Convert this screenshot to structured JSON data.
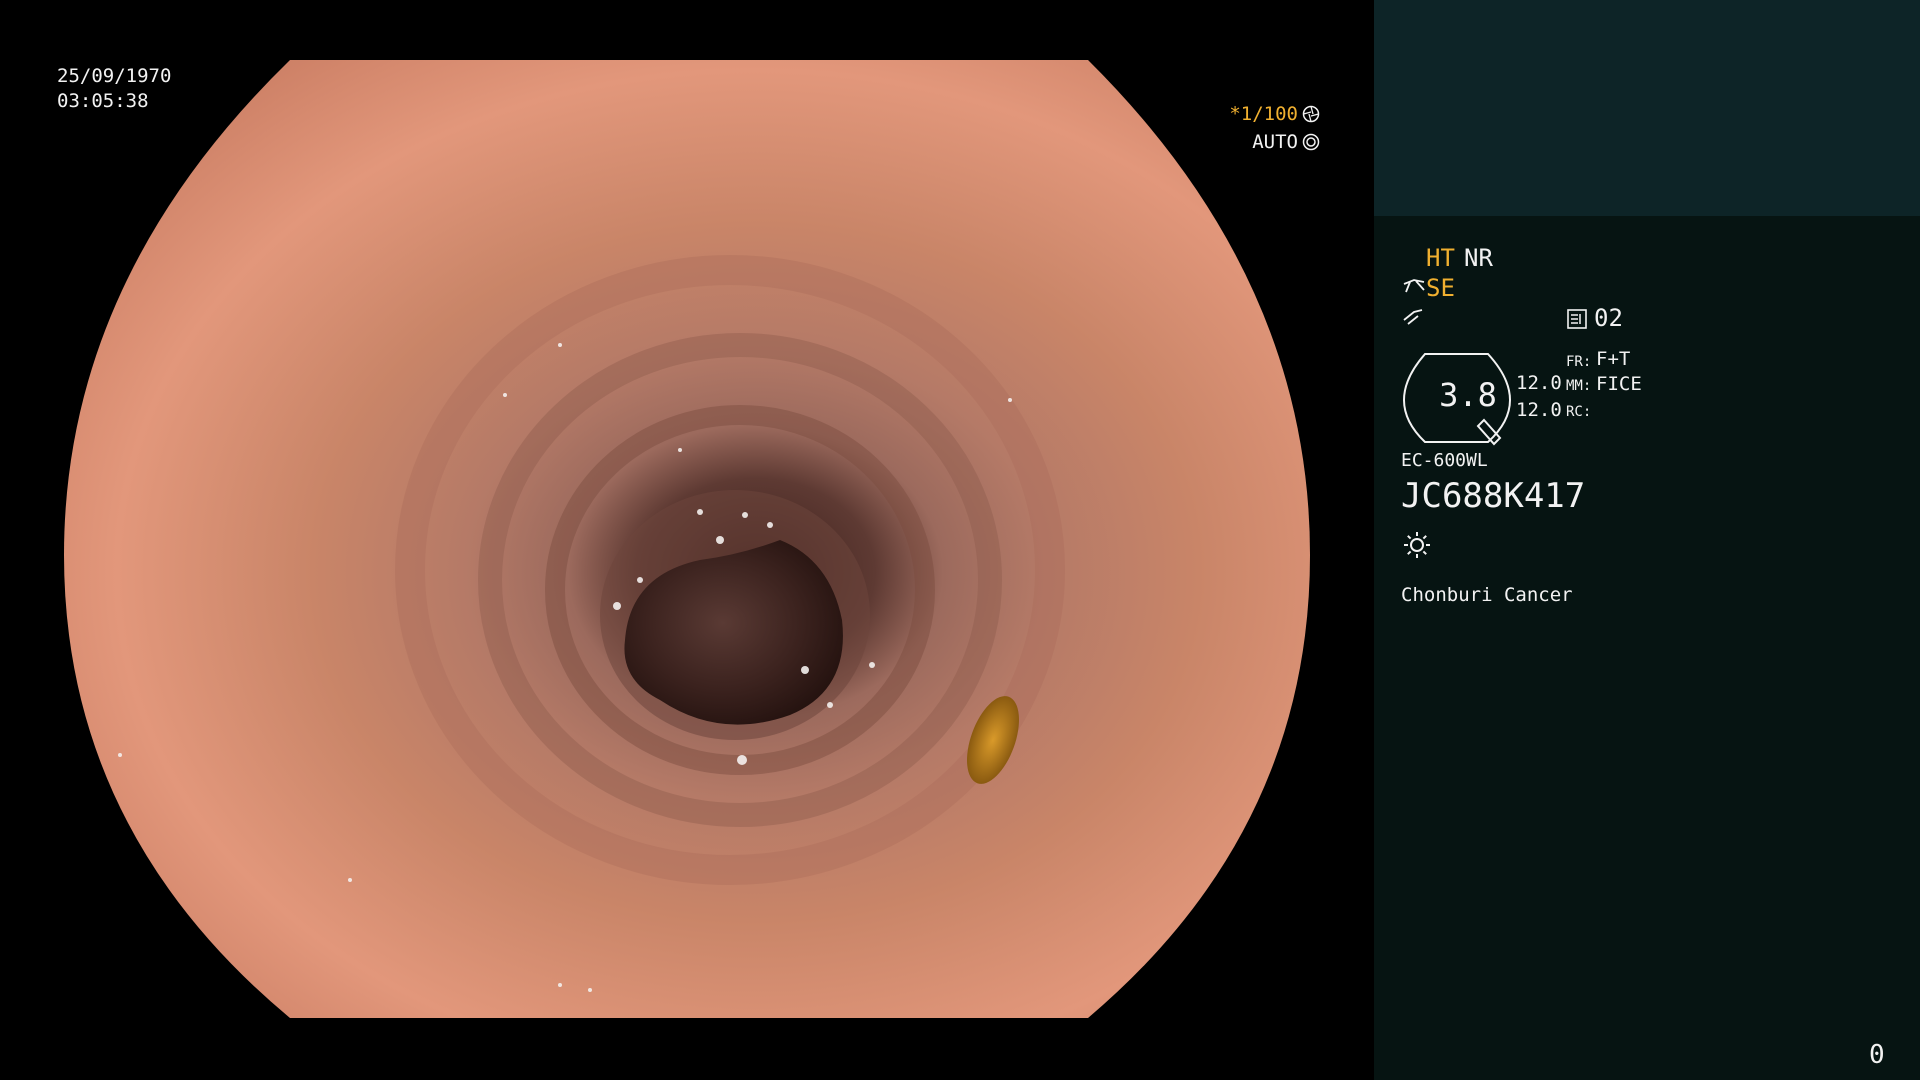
{
  "overlay": {
    "date": "25/09/1970",
    "time": "03:05:38",
    "shutter": "*1/100",
    "exposure": "AUTO"
  },
  "panel": {
    "ht": "HT",
    "nr": "NR",
    "se": "SE",
    "memory": "02",
    "gauge_value": "3.8",
    "gauge_line1": "12.0",
    "gauge_line2": "12.0",
    "fr_label": "FR:",
    "fr_value": "F+T",
    "mm_label": "MM:",
    "mm_value": "FICE",
    "rc_label": "RC:",
    "scope_model": "EC-600WL",
    "serial": "JC688K417",
    "hospital": "Chonburi Cancer",
    "counter": "0"
  },
  "icons": {
    "shutter": "aperture-icon",
    "exposure": "iris-icon",
    "se": "scope-enhance-icon",
    "edge": "edge-icon",
    "memory": "memory-card-icon",
    "light": "light-icon"
  },
  "colors": {
    "accent_yellow": "#f0b030",
    "panel_bg": "#061412",
    "panel_top_bg": "#0d2427"
  }
}
